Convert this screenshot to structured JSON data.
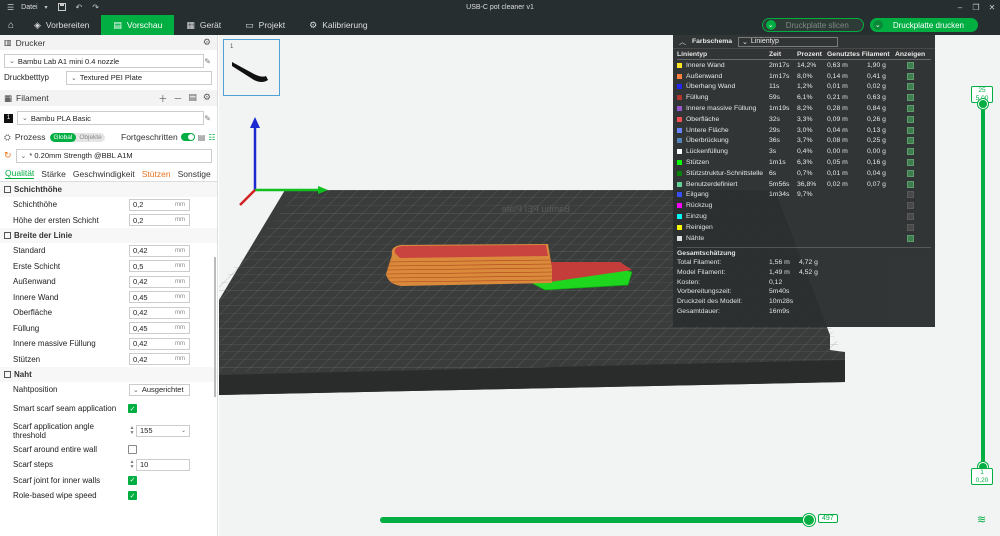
{
  "window": {
    "title": "USB-C pot cleaner v1",
    "file_menu": "Datei"
  },
  "menu": {
    "tabs": [
      {
        "label": "Vorbereiten"
      },
      {
        "label": "Vorschau"
      },
      {
        "label": "Gerät"
      },
      {
        "label": "Projekt"
      },
      {
        "label": "Kalibrierung"
      }
    ],
    "slice_button": "Druckplatte slicen",
    "print_button": "Druckplatte drucken"
  },
  "printer": {
    "section": "Drucker",
    "name": "Bambu Lab A1 mini 0.4 nozzle",
    "bed_label": "Druckbetttyp",
    "bed": "Textured PEI Plate"
  },
  "filament": {
    "section": "Filament",
    "slot": "1",
    "name": "Bambu PLA Basic"
  },
  "process": {
    "section": "Prozess",
    "global": "Global",
    "objects": "Objekte",
    "advanced": "Fortgeschritten",
    "preset": "* 0.20mm Strength @BBL A1M",
    "tabs": [
      "Qualität",
      "Stärke",
      "Geschwindigkeit",
      "Stützen",
      "Sonstige"
    ]
  },
  "quality": {
    "g1": "Schichthöhe",
    "layer_height": {
      "label": "Schichthöhe",
      "value": "0,2",
      "unit": "mm"
    },
    "first_layer": {
      "label": "Höhe der ersten Schicht",
      "value": "0,2",
      "unit": "mm"
    },
    "g2": "Breite der Linie",
    "widths": [
      {
        "label": "Standard",
        "value": "0,42",
        "unit": "mm"
      },
      {
        "label": "Erste Schicht",
        "value": "0,5",
        "unit": "mm"
      },
      {
        "label": "Außenwand",
        "value": "0,42",
        "unit": "mm"
      },
      {
        "label": "Innere Wand",
        "value": "0,45",
        "unit": "mm"
      },
      {
        "label": "Oberfläche",
        "value": "0,42",
        "unit": "mm"
      },
      {
        "label": "Füllung",
        "value": "0,45",
        "unit": "mm"
      },
      {
        "label": "Innere massive Füllung",
        "value": "0,42",
        "unit": "mm"
      },
      {
        "label": "Stützen",
        "value": "0,42",
        "unit": "mm"
      }
    ],
    "g3": "Naht",
    "seam_position": {
      "label": "Nahtposition",
      "value": "Ausgerichtet"
    },
    "smart_scarf": {
      "label": "Smart scarf seam application"
    },
    "scarf_angle": {
      "label": "Scarf application angle threshold",
      "value": "155"
    },
    "scarf_around": {
      "label": "Scarf around entire wall"
    },
    "scarf_steps": {
      "label": "Scarf steps",
      "value": "10"
    },
    "scarf_inner": {
      "label": "Scarf joint for inner walls"
    },
    "role_wipe": {
      "label": "Role-based wipe speed"
    }
  },
  "legend": {
    "title": "Farbschema",
    "mode": "Linientyp",
    "headers": [
      "Linientyp",
      "Zeit",
      "Prozent",
      "Genutztes Filament",
      "Anzeigen"
    ],
    "rows": [
      {
        "name": "Innere Wand",
        "time": "2m17s",
        "pct": "14,2%",
        "m": "0,63 m",
        "g": "1,90 g",
        "color": "#ffe61e",
        "show": true
      },
      {
        "name": "Außenwand",
        "time": "1m17s",
        "pct": "8,0%",
        "m": "0,14 m",
        "g": "0,41 g",
        "color": "#ff7d38",
        "show": true
      },
      {
        "name": "Überhang Wand",
        "time": "11s",
        "pct": "1,2%",
        "m": "0,01 m",
        "g": "0,02 g",
        "color": "#1f1fff",
        "show": true
      },
      {
        "name": "Füllung",
        "time": "59s",
        "pct": "6,1%",
        "m": "0,21 m",
        "g": "0,63 g",
        "color": "#b03029",
        "show": true
      },
      {
        "name": "Innere massive Füllung",
        "time": "1m19s",
        "pct": "8,2%",
        "m": "0,28 m",
        "g": "0,84 g",
        "color": "#9654cc",
        "show": true
      },
      {
        "name": "Oberfläche",
        "time": "32s",
        "pct": "3,3%",
        "m": "0,09 m",
        "g": "0,26 g",
        "color": "#f04c4c",
        "show": true
      },
      {
        "name": "Untere Fläche",
        "time": "29s",
        "pct": "3,0%",
        "m": "0,04 m",
        "g": "0,13 g",
        "color": "#6680ff",
        "show": true
      },
      {
        "name": "Überbrückung",
        "time": "36s",
        "pct": "3,7%",
        "m": "0,08 m",
        "g": "0,25 g",
        "color": "#4d80ba",
        "show": true
      },
      {
        "name": "Lückenfüllung",
        "time": "3s",
        "pct": "0,4%",
        "m": "0,00 m",
        "g": "0,00 g",
        "color": "#ffffff",
        "show": true
      },
      {
        "name": "Stützen",
        "time": "1m1s",
        "pct": "6,3%",
        "m": "0,05 m",
        "g": "0,16 g",
        "color": "#00ff00",
        "show": true
      },
      {
        "name": "Stützstruktur-Schnittstelle",
        "time": "6s",
        "pct": "0,7%",
        "m": "0,01 m",
        "g": "0,04 g",
        "color": "#008000",
        "show": true
      },
      {
        "name": "Benutzerdefiniert",
        "time": "5m56s",
        "pct": "36,8%",
        "m": "0,02 m",
        "g": "0,07 g",
        "color": "#5ed194",
        "show": true
      },
      {
        "name": "Eilgang",
        "time": "1m34s",
        "pct": "9,7%",
        "m": "",
        "g": "",
        "color": "#384fff",
        "show": false
      },
      {
        "name": "Rückzug",
        "time": "",
        "pct": "",
        "m": "",
        "g": "",
        "color": "#ff00ff",
        "show": false
      },
      {
        "name": "Einzug",
        "time": "",
        "pct": "",
        "m": "",
        "g": "",
        "color": "#00ffff",
        "show": false
      },
      {
        "name": "Reinigen",
        "time": "",
        "pct": "",
        "m": "",
        "g": "",
        "color": "#ffff00",
        "show": false
      },
      {
        "name": "Nähte",
        "time": "",
        "pct": "",
        "m": "",
        "g": "",
        "color": "#e6e6e6",
        "show": true
      }
    ],
    "summary_title": "Gesamtschätzung",
    "summary": [
      {
        "k": "Total Filament:",
        "v1": "1,56 m",
        "v2": "4,72 g"
      },
      {
        "k": "Model Filament:",
        "v1": "1,49 m",
        "v2": "4,52 g"
      },
      {
        "k": "Kosten:",
        "v1": "0,12",
        "v2": ""
      },
      {
        "k": "Vorbereitungszeit:",
        "v1": "5m40s",
        "v2": ""
      },
      {
        "k": "Druckzeit des Modell:",
        "v1": "10m28s",
        "v2": ""
      },
      {
        "k": "Gesamtdauer:",
        "v1": "16m9s",
        "v2": ""
      }
    ]
  },
  "layer_slider": {
    "top_layer": "25",
    "top_height": "5,00",
    "bottom_layer": "1",
    "bottom_height": "0,20"
  },
  "move_slider": {
    "value": "497"
  },
  "thumb": {
    "index": "1"
  },
  "colors": {
    "accent": "#00ae42",
    "dark": "#262e30",
    "orange": "#e9731d"
  }
}
